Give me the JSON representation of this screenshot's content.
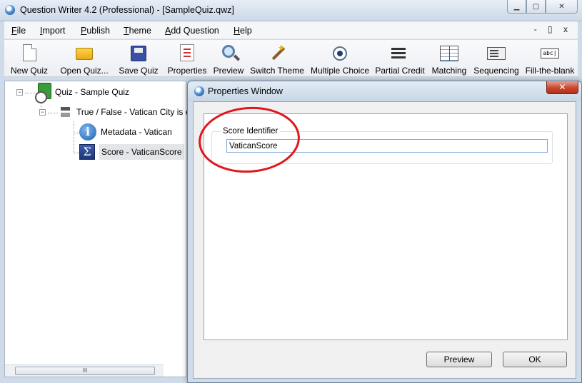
{
  "window": {
    "title": "Question Writer 4.2 (Professional) - [SampleQuiz.qwz]",
    "controls": {
      "minimize": "▁",
      "maximize": "▢",
      "close": "✕"
    }
  },
  "menu": {
    "items": [
      "File",
      "Import",
      "Publish",
      "Theme",
      "Add Question",
      "Help"
    ],
    "mdi_controls": "- ▯ x"
  },
  "toolbar": {
    "buttons": [
      {
        "label": "New Quiz",
        "icon": "new-document-icon"
      },
      {
        "label": "Open Quiz...",
        "icon": "open-folder-icon"
      },
      {
        "label": "Save Quiz",
        "icon": "floppy-disk-icon"
      },
      {
        "label": "Properties",
        "icon": "properties-icon"
      },
      {
        "label": "Preview",
        "icon": "magnifier-icon"
      },
      {
        "label": "Switch Theme",
        "icon": "magic-wand-icon"
      },
      {
        "label": "Multiple Choice",
        "icon": "radio-button-icon"
      },
      {
        "label": "Partial Credit",
        "icon": "list-icon"
      },
      {
        "label": "Matching",
        "icon": "grid-icon"
      },
      {
        "label": "Sequencing",
        "icon": "sequence-icon"
      },
      {
        "label": "Fill-the-blank",
        "icon": "fill-blank-icon"
      }
    ]
  },
  "tree": {
    "root": {
      "label": "Quiz - Sample Quiz",
      "expander": "−"
    },
    "question": {
      "label": "True / False - Vatican City is ent",
      "expander": "−"
    },
    "metadata": {
      "label": "Metadata - Vatican"
    },
    "score": {
      "label": "Score - VaticanScore"
    },
    "scroll_grip": "III"
  },
  "properties_window": {
    "title": "Properties Window",
    "close": "✕",
    "score_group_label": "Score Identifier",
    "score_value": "VaticanScore",
    "preview_label": "Preview",
    "ok_label": "OK"
  },
  "colors": {
    "annotation": "#e0161b",
    "selection": "#e3e5e8"
  }
}
